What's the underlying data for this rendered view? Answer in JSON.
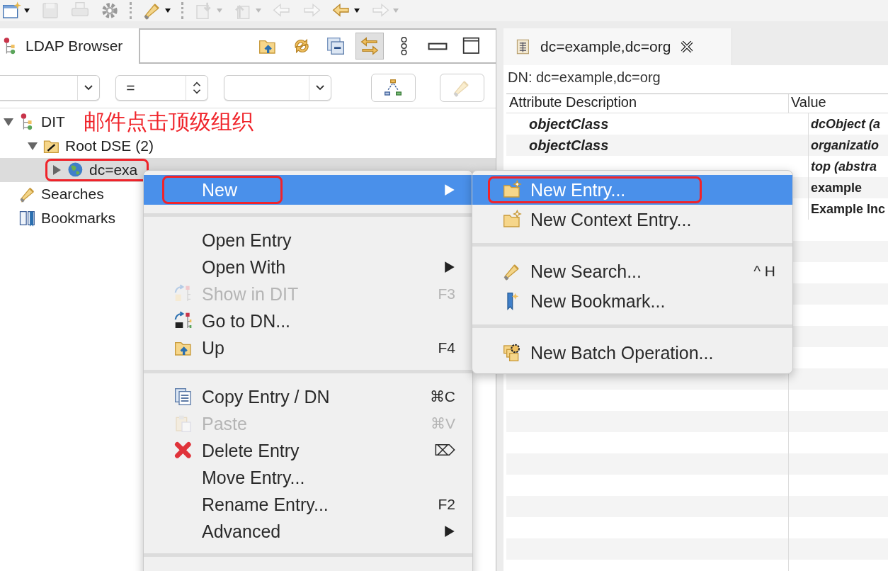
{
  "toolbar": [
    {
      "kind": "new-window",
      "disabled": false,
      "dropdown": true
    },
    {
      "kind": "save",
      "disabled": true,
      "dropdown": false
    },
    {
      "kind": "print",
      "disabled": true,
      "dropdown": false
    },
    {
      "kind": "gear",
      "disabled": false,
      "dropdown": false
    },
    {
      "kind": "separator"
    },
    {
      "kind": "search",
      "disabled": false,
      "dropdown": true
    },
    {
      "kind": "separator"
    },
    {
      "kind": "import",
      "disabled": true,
      "dropdown": true
    },
    {
      "kind": "export",
      "disabled": true,
      "dropdown": true
    },
    {
      "kind": "back-star",
      "disabled": true,
      "dropdown": false
    },
    {
      "kind": "forward-star",
      "disabled": true,
      "dropdown": false
    },
    {
      "kind": "back",
      "disabled": false,
      "dropdown": true
    },
    {
      "kind": "forward",
      "disabled": true,
      "dropdown": true
    }
  ],
  "view": {
    "title": "LDAP Browser",
    "tools": [
      {
        "kind": "folder-up",
        "selected": false
      },
      {
        "kind": "sync",
        "selected": false
      },
      {
        "kind": "collapse",
        "selected": false
      },
      {
        "kind": "link",
        "selected": true
      },
      {
        "kind": "more",
        "selected": false
      },
      {
        "kind": "minimize",
        "selected": false
      },
      {
        "kind": "maximize",
        "selected": false
      }
    ],
    "filters": [
      {
        "kind": "combo"
      },
      {
        "kind": "spinner",
        "value": "="
      },
      {
        "kind": "combo"
      }
    ],
    "filter_buttons": [
      {
        "kind": "hierarchy",
        "disabled": false
      },
      {
        "kind": "search",
        "disabled": true
      }
    ],
    "note": "邮件点击顶级组织",
    "tree": [
      {
        "kind": "dit",
        "label": "DIT",
        "expanded": true,
        "selected": false,
        "annotated": false,
        "children": [
          {
            "kind": "root",
            "label": "Root DSE (2)",
            "expanded": true,
            "selected": false,
            "annotated": false,
            "children": [
              {
                "kind": "entry",
                "label": "dc=exa",
                "expanded": false,
                "selected": true,
                "annotated": true
              }
            ]
          }
        ]
      },
      {
        "kind": "searches",
        "label": "Searches",
        "selected": false,
        "annotated": false
      },
      {
        "kind": "bookmarks",
        "label": "Bookmarks",
        "selected": false,
        "annotated": false
      }
    ]
  },
  "editor": {
    "tab": "dc=example,dc=org",
    "dn": "DN: dc=example,dc=org",
    "columns": [
      "Attribute Description",
      "Value"
    ],
    "rows": [
      {
        "attribute": "objectClass",
        "value": "dcObject (a"
      },
      {
        "attribute": "objectClass",
        "value": "organizatio"
      },
      {
        "value": "top (abstra"
      },
      {
        "value": "example"
      },
      {
        "value": "Example Inc"
      }
    ]
  },
  "context_menu": [
    {
      "kind": "item",
      "label": "New",
      "submenu": true,
      "selected": true,
      "disabled": false,
      "annotated": true
    },
    {
      "kind": "separator"
    },
    {
      "kind": "item",
      "label": "Open Entry",
      "selected": false,
      "disabled": false
    },
    {
      "kind": "item",
      "label": "Open With",
      "submenu": true,
      "selected": false,
      "disabled": false
    },
    {
      "kind": "item",
      "label": "Show in DIT",
      "shortcut": "F3",
      "selected": false,
      "disabled": true
    },
    {
      "kind": "item",
      "label": "Go to DN...",
      "selected": false,
      "disabled": false
    },
    {
      "kind": "item",
      "label": "Up",
      "shortcut": "F4",
      "selected": false,
      "disabled": false
    },
    {
      "kind": "separator"
    },
    {
      "kind": "item",
      "label": "Copy Entry / DN",
      "shortcut": "⌘C",
      "selected": false,
      "disabled": false
    },
    {
      "kind": "item",
      "label": "Paste",
      "shortcut": "⌘V",
      "selected": false,
      "disabled": true
    },
    {
      "kind": "item",
      "label": "Delete Entry",
      "shortcut": "⌦",
      "selected": false,
      "disabled": false
    },
    {
      "kind": "item",
      "label": "Move Entry...",
      "selected": false,
      "disabled": false
    },
    {
      "kind": "item",
      "label": "Rename Entry...",
      "shortcut": "F2",
      "selected": false,
      "disabled": false
    },
    {
      "kind": "item",
      "label": "Advanced",
      "submenu": true,
      "selected": false,
      "disabled": false
    },
    {
      "kind": "separator"
    }
  ],
  "submenu": [
    {
      "kind": "item",
      "label": "New Entry...",
      "selected": true,
      "disabled": false,
      "annotated": true
    },
    {
      "kind": "item",
      "label": "New Context Entry...",
      "selected": false,
      "disabled": false
    },
    {
      "kind": "separator"
    },
    {
      "kind": "item",
      "label": "New Search...",
      "shortcut": "^ H",
      "selected": false,
      "disabled": false
    },
    {
      "kind": "item",
      "label": "New Bookmark...",
      "selected": false,
      "disabled": false
    },
    {
      "kind": "separator"
    },
    {
      "kind": "item",
      "label": "New Batch Operation...",
      "selected": false,
      "disabled": false
    }
  ]
}
